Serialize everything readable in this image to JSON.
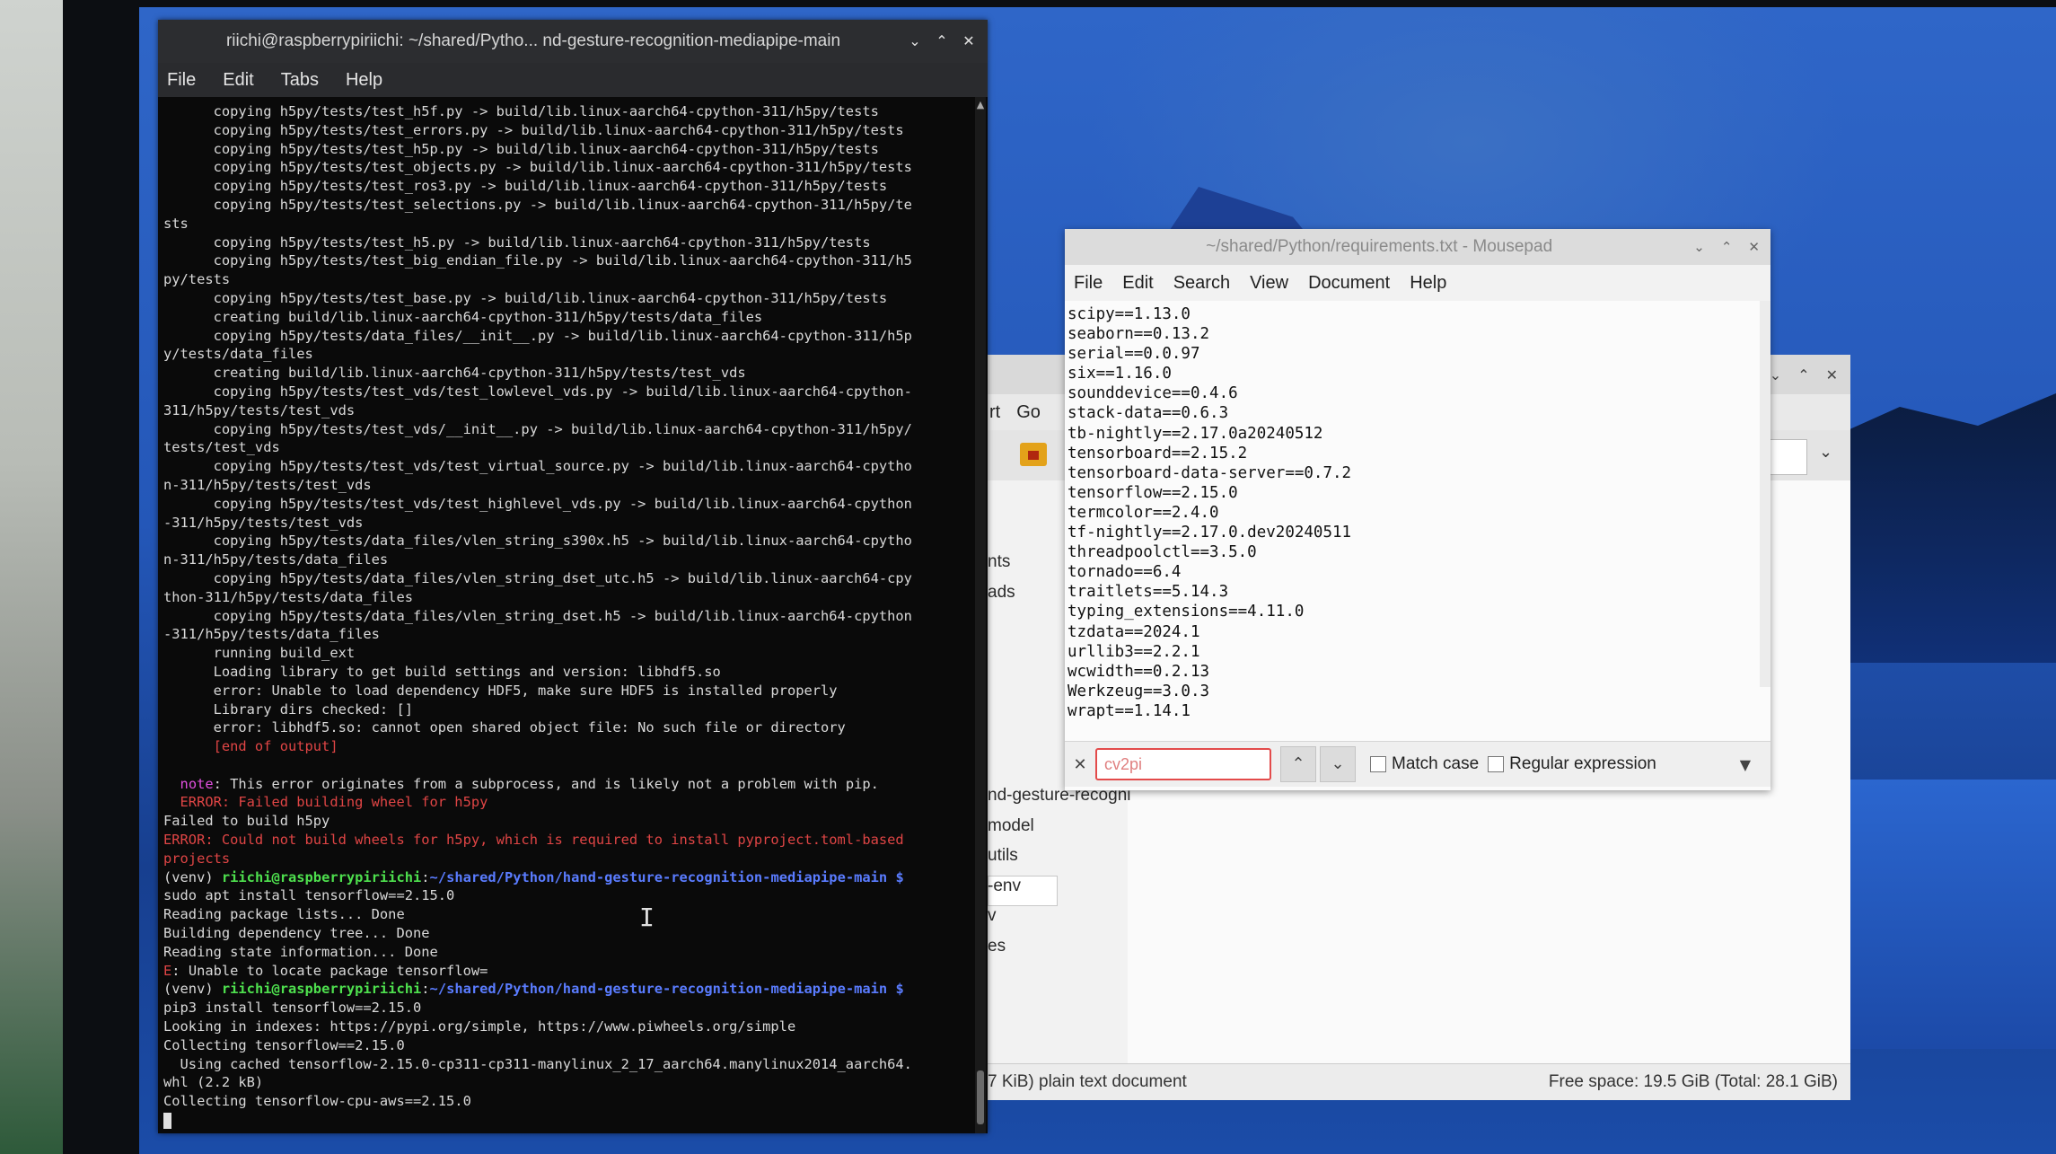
{
  "terminal": {
    "title": "riichi@raspberrypiriichi: ~/shared/Pytho... nd-gesture-recognition-mediapipe-main",
    "menu": [
      "File",
      "Edit",
      "Tabs",
      "Help"
    ],
    "lines": [
      {
        "t": "      copying h5py/tests/test_h5f.py -> build/lib.linux-aarch64-cpython-311/h5py/tests"
      },
      {
        "t": "      copying h5py/tests/test_errors.py -> build/lib.linux-aarch64-cpython-311/h5py/tests"
      },
      {
        "t": "      copying h5py/tests/test_h5p.py -> build/lib.linux-aarch64-cpython-311/h5py/tests"
      },
      {
        "t": "      copying h5py/tests/test_objects.py -> build/lib.linux-aarch64-cpython-311/h5py/tests"
      },
      {
        "t": "      copying h5py/tests/test_ros3.py -> build/lib.linux-aarch64-cpython-311/h5py/tests"
      },
      {
        "t": "      copying h5py/tests/test_selections.py -> build/lib.linux-aarch64-cpython-311/h5py/te"
      },
      {
        "t": "sts"
      },
      {
        "t": "      copying h5py/tests/test_h5.py -> build/lib.linux-aarch64-cpython-311/h5py/tests"
      },
      {
        "t": "      copying h5py/tests/test_big_endian_file.py -> build/lib.linux-aarch64-cpython-311/h5"
      },
      {
        "t": "py/tests"
      },
      {
        "t": "      copying h5py/tests/test_base.py -> build/lib.linux-aarch64-cpython-311/h5py/tests"
      },
      {
        "t": "      creating build/lib.linux-aarch64-cpython-311/h5py/tests/data_files"
      },
      {
        "t": "      copying h5py/tests/data_files/__init__.py -> build/lib.linux-aarch64-cpython-311/h5p"
      },
      {
        "t": "y/tests/data_files"
      },
      {
        "t": "      creating build/lib.linux-aarch64-cpython-311/h5py/tests/test_vds"
      },
      {
        "t": "      copying h5py/tests/test_vds/test_lowlevel_vds.py -> build/lib.linux-aarch64-cpython-"
      },
      {
        "t": "311/h5py/tests/test_vds"
      },
      {
        "t": "      copying h5py/tests/test_vds/__init__.py -> build/lib.linux-aarch64-cpython-311/h5py/"
      },
      {
        "t": "tests/test_vds"
      },
      {
        "t": "      copying h5py/tests/test_vds/test_virtual_source.py -> build/lib.linux-aarch64-cpytho"
      },
      {
        "t": "n-311/h5py/tests/test_vds"
      },
      {
        "t": "      copying h5py/tests/test_vds/test_highlevel_vds.py -> build/lib.linux-aarch64-cpython"
      },
      {
        "t": "-311/h5py/tests/test_vds"
      },
      {
        "t": "      copying h5py/tests/data_files/vlen_string_s390x.h5 -> build/lib.linux-aarch64-cpytho"
      },
      {
        "t": "n-311/h5py/tests/data_files"
      },
      {
        "t": "      copying h5py/tests/data_files/vlen_string_dset_utc.h5 -> build/lib.linux-aarch64-cpy"
      },
      {
        "t": "thon-311/h5py/tests/data_files"
      },
      {
        "t": "      copying h5py/tests/data_files/vlen_string_dset.h5 -> build/lib.linux-aarch64-cpython"
      },
      {
        "t": "-311/h5py/tests/data_files"
      },
      {
        "t": "      running build_ext"
      },
      {
        "t": "      Loading library to get build settings and version: libhdf5.so"
      },
      {
        "t": "      error: Unable to load dependency HDF5, make sure HDF5 is installed properly"
      },
      {
        "t": "      Library dirs checked: []"
      },
      {
        "t": "      error: libhdf5.so: cannot open shared object file: No such file or directory"
      },
      {
        "t": "      [end of output]",
        "c": "red"
      },
      {
        "t": ""
      },
      {
        "segs": [
          {
            "t": "  "
          },
          {
            "t": "note",
            "c": "magenta"
          },
          {
            "t": ": This error originates from a subprocess, and is likely not a problem with pip."
          }
        ]
      },
      {
        "t": "  ERROR: Failed building wheel for h5py",
        "c": "red"
      },
      {
        "t": "Failed to build h5py"
      },
      {
        "t": "ERROR: Could not build wheels for h5py, which is required to install pyproject.toml-based",
        "c": "red"
      },
      {
        "t": "projects",
        "c": "red"
      },
      {
        "segs": [
          {
            "t": "(venv) "
          },
          {
            "t": "riichi@raspberrypiriichi",
            "c": "green"
          },
          {
            "t": ":"
          },
          {
            "t": "~/shared/Python/hand-gesture-recognition-mediapipe-main $",
            "c": "blue"
          }
        ]
      },
      {
        "t": "sudo apt install tensorflow==2.15.0"
      },
      {
        "t": "Reading package lists... Done"
      },
      {
        "t": "Building dependency tree... Done"
      },
      {
        "t": "Reading state information... Done"
      },
      {
        "segs": [
          {
            "t": "E",
            "c": "red"
          },
          {
            "t": ": Unable to locate package tensorflow="
          }
        ]
      },
      {
        "segs": [
          {
            "t": "(venv) "
          },
          {
            "t": "riichi@raspberrypiriichi",
            "c": "green"
          },
          {
            "t": ":"
          },
          {
            "t": "~/shared/Python/hand-gesture-recognition-mediapipe-main $",
            "c": "blue"
          }
        ]
      },
      {
        "t": "pip3 install tensorflow==2.15.0"
      },
      {
        "t": "Looking in indexes: https://pypi.org/simple, https://www.piwheels.org/simple"
      },
      {
        "t": "Collecting tensorflow==2.15.0"
      },
      {
        "t": "  Using cached tensorflow-2.15.0-cp311-cp311-manylinux_2_17_aarch64.manylinux2014_aarch64."
      },
      {
        "t": "whl (2.2 kB)"
      },
      {
        "t": "Collecting tensorflow-cpu-aws==2.15.0"
      }
    ]
  },
  "filemanager": {
    "menu": [
      "rt",
      "Go"
    ],
    "sidebar_items": [
      "nts",
      "ads"
    ],
    "files": [
      "nd-gesture-recogni",
      "model",
      "utils",
      "-env",
      "v",
      "es"
    ],
    "status_left": "7 KiB) plain text document",
    "status_right": "Free space: 19.5 GiB (Total: 28.1 GiB)"
  },
  "mousepad": {
    "title": "~/shared/Python/requirements.txt - Mousepad",
    "menu": [
      "File",
      "Edit",
      "Search",
      "View",
      "Document",
      "Help"
    ],
    "lines": [
      "scipy==1.13.0",
      "seaborn==0.13.2",
      "serial==0.0.97",
      "six==1.16.0",
      "sounddevice==0.4.6",
      "stack-data==0.6.3",
      "tb-nightly==2.17.0a20240512",
      "tensorboard==2.15.2",
      "tensorboard-data-server==0.7.2",
      "tensorflow==2.15.0",
      "termcolor==2.4.0",
      "tf-nightly==2.17.0.dev20240511",
      "threadpoolctl==3.5.0",
      "tornado==6.4",
      "traitlets==5.14.3",
      "typing_extensions==4.11.0",
      "tzdata==2024.1",
      "urllib3==2.2.1",
      "wcwidth==0.2.13",
      "Werkzeug==3.0.3",
      "wrapt==1.14.1"
    ],
    "search": {
      "value": "cv2pi",
      "match_case": "Match case",
      "regex": "Regular expression"
    }
  }
}
